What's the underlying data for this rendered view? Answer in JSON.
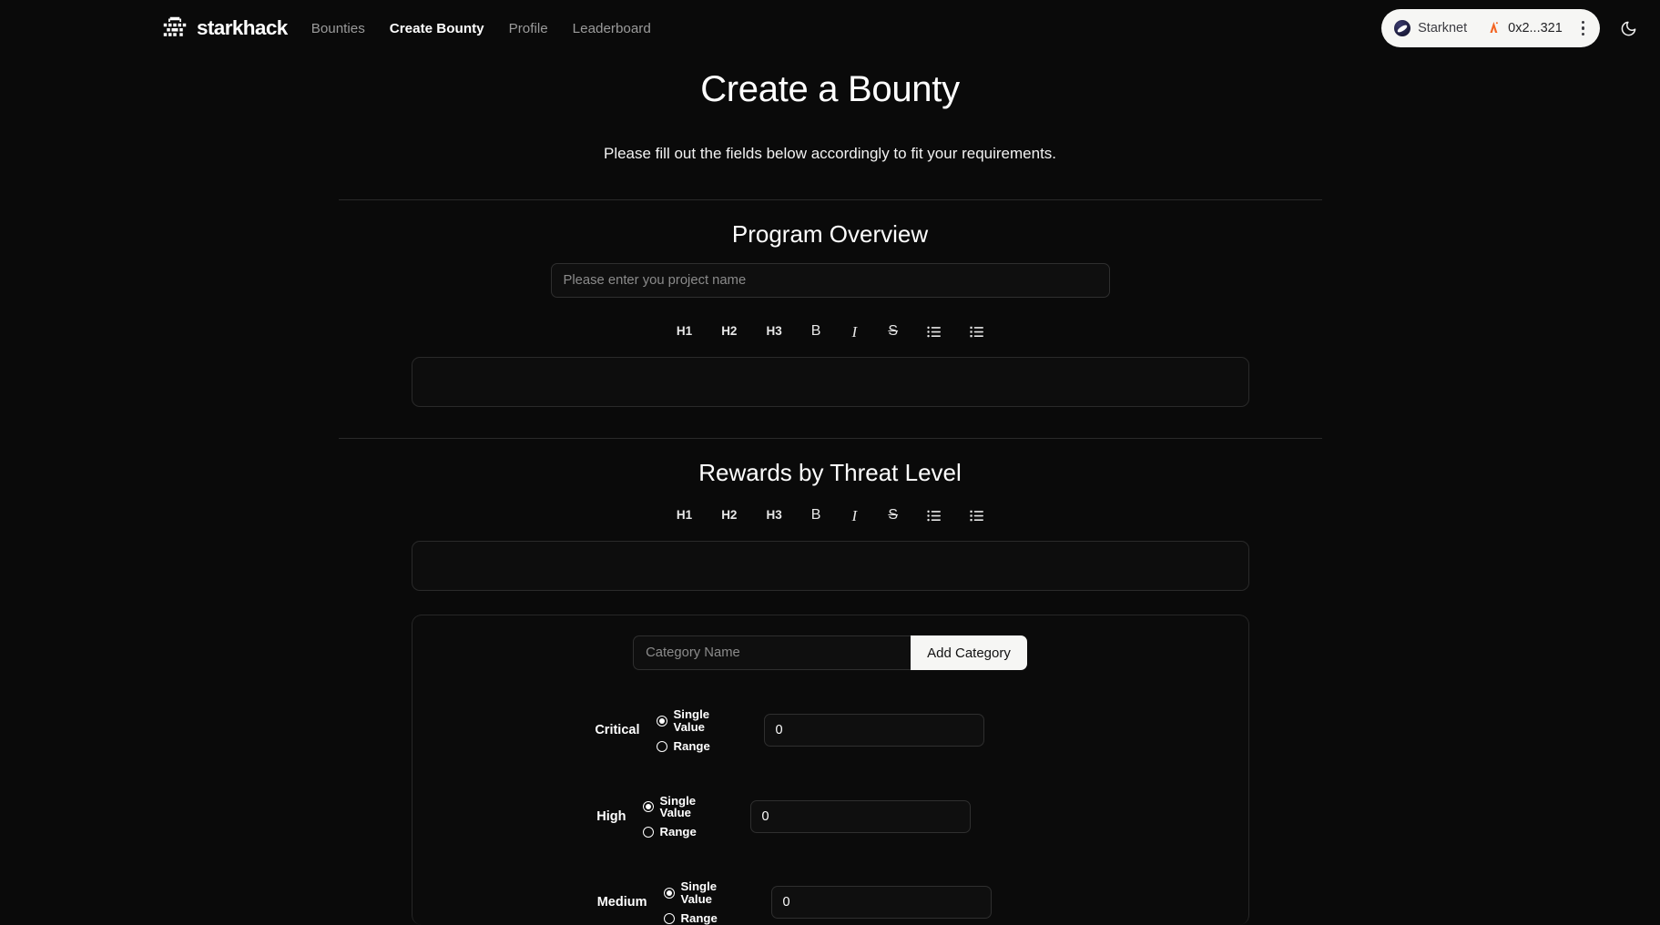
{
  "navbar": {
    "brand": {
      "name": "starkhack",
      "mark_icon": "starkhack-pixel-logo"
    },
    "links": [
      {
        "label": "Bounties",
        "active": false
      },
      {
        "label": "Create Bounty",
        "active": true
      },
      {
        "label": "Profile",
        "active": false
      },
      {
        "label": "Leaderboard",
        "active": false
      }
    ],
    "wallet": {
      "network": "Starknet",
      "network_icon": "starknet-icon",
      "address": "0x2...321",
      "address_icon": "argent-wallet-icon",
      "menu_icon": "kebab-menu-icon"
    },
    "theme_toggle": {
      "icon": "moon-icon",
      "mode": "dark"
    }
  },
  "page": {
    "title": "Create a Bounty",
    "subtitle": "Please fill out the fields below accordingly to fit your requirements."
  },
  "program_overview": {
    "title": "Program Overview",
    "project_name": {
      "value": "",
      "placeholder": "Please enter you project name"
    },
    "editor": {
      "toolbar": [
        {
          "label": "H1",
          "name": "heading-1"
        },
        {
          "label": "H2",
          "name": "heading-2"
        },
        {
          "label": "H3",
          "name": "heading-3"
        },
        {
          "label": "B",
          "name": "bold"
        },
        {
          "label": "I",
          "name": "italic"
        },
        {
          "label": "S",
          "name": "strikethrough"
        },
        {
          "label": "",
          "name": "bullet-list"
        },
        {
          "label": "",
          "name": "ordered-list"
        }
      ],
      "content": ""
    }
  },
  "rewards": {
    "title": "Rewards by Threat Level",
    "editor": {
      "toolbar": [
        {
          "label": "H1",
          "name": "heading-1"
        },
        {
          "label": "H2",
          "name": "heading-2"
        },
        {
          "label": "H3",
          "name": "heading-3"
        },
        {
          "label": "B",
          "name": "bold"
        },
        {
          "label": "I",
          "name": "italic"
        },
        {
          "label": "S",
          "name": "strikethrough"
        },
        {
          "label": "",
          "name": "bullet-list"
        },
        {
          "label": "",
          "name": "ordered-list"
        }
      ],
      "content": ""
    },
    "category": {
      "input": {
        "value": "",
        "placeholder": "Category Name"
      },
      "add_button": "Add Category"
    },
    "single_value_label": "Single Value",
    "range_label": "Range",
    "levels": [
      {
        "label": "Critical",
        "mode": "single",
        "value": "0"
      },
      {
        "label": "High",
        "mode": "single",
        "value": "0"
      },
      {
        "label": "Medium",
        "mode": "single",
        "value": "0"
      }
    ]
  },
  "colors": {
    "background": "#0a0a0a",
    "text": "#ffffff",
    "muted": "#9a9a9a",
    "pill_background": "#f6f6f4",
    "border": "#2f2f2f",
    "accent_orange": "#f36523"
  }
}
